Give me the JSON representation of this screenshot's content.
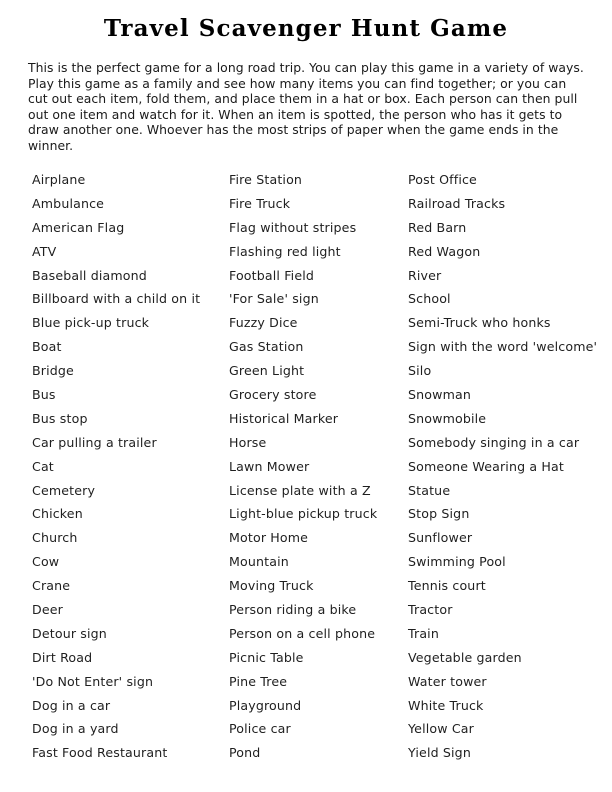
{
  "document": {
    "title": "Travel Scavenger Hunt Game",
    "intro": "This is the perfect game for a long road trip. You can play this game in a variety of ways. Play this game as a family and see how many items you can find together; or you can cut out each item, fold them, and place them in a hat or box. Each person can then pull out one item and watch for it.  When an item is spotted, the person who has it gets to draw another one. Whoever has the most strips of paper when the game ends in the winner.",
    "background_color": "#ffffff",
    "text_color": "#1a1a1a"
  },
  "columns": [
    {
      "name": "column-1",
      "items": [
        "Airplane",
        "Ambulance",
        "American Flag",
        "ATV",
        "Baseball diamond",
        "Billboard with a child on it",
        "Blue pick-up truck",
        "Boat",
        "Bridge",
        "Bus",
        "Bus stop",
        "Car pulling a trailer",
        "Cat",
        "Cemetery",
        "Chicken",
        "Church",
        "Cow",
        "Crane",
        "Deer",
        "Detour sign",
        "Dirt Road",
        "'Do Not Enter' sign",
        "Dog in a car",
        "Dog in a yard",
        "Fast Food Restaurant"
      ]
    },
    {
      "name": "column-2",
      "items": [
        "Fire Station",
        "Fire Truck",
        "Flag without stripes",
        "Flashing red light",
        "Football Field",
        "'For Sale' sign",
        "Fuzzy Dice",
        "Gas Station",
        "Green Light",
        "Grocery store",
        "Historical Marker",
        "Horse",
        "Lawn Mower",
        "License plate with a Z",
        "Light-blue pickup truck",
        "Motor Home",
        "Mountain",
        "Moving Truck",
        "Person riding a bike",
        "Person on a cell phone",
        "Picnic Table",
        "Pine Tree",
        "Playground",
        "Police car",
        "Pond"
      ]
    },
    {
      "name": "column-3",
      "items": [
        "Post Office",
        "Railroad Tracks",
        "Red Barn",
        "Red Wagon",
        "River",
        "School",
        "Semi-Truck who honks",
        "Sign with the word 'welcome'",
        "Silo",
        "Snowman",
        "Snowmobile",
        "Somebody singing in a car",
        "Someone Wearing a Hat",
        "Statue",
        "Stop Sign",
        "Sunflower",
        "Swimming Pool",
        "Tennis court",
        "Tractor",
        "Train",
        "Vegetable garden",
        "Water tower",
        "White Truck",
        "Yellow Car",
        "Yield Sign"
      ]
    }
  ]
}
